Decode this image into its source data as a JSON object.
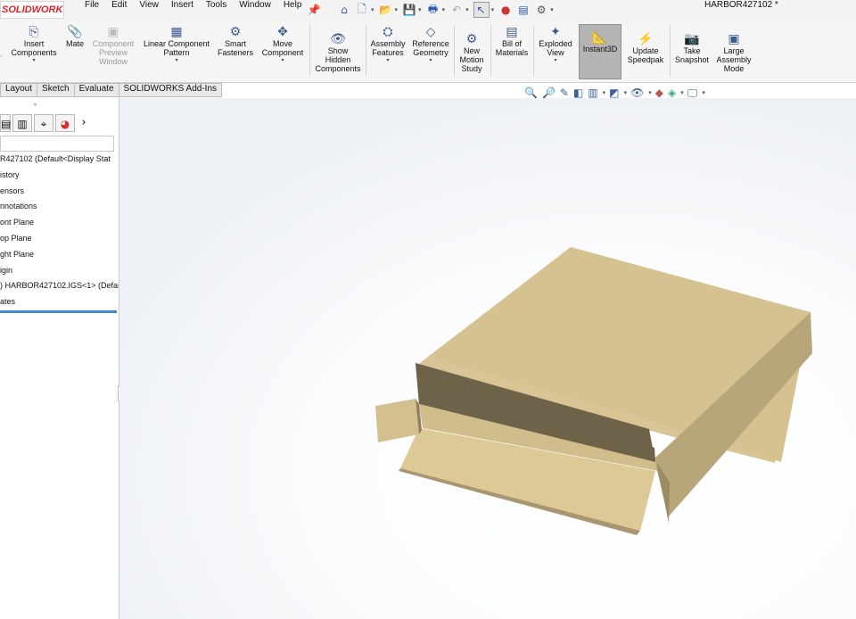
{
  "app": {
    "logo": "SOLIDWORKS",
    "document_title": "HARBOR427102 *"
  },
  "menu": {
    "items": [
      "File",
      "Edit",
      "View",
      "Insert",
      "Tools",
      "Window",
      "Help"
    ]
  },
  "quick_access": [
    "pin-icon",
    "home-icon",
    "new-icon",
    "open-icon",
    "save-icon",
    "print-icon",
    "undo-icon",
    "select-icon",
    "traffic-light-icon",
    "options-icon",
    "settings-icon"
  ],
  "ribbon": {
    "insert_components": "Insert\nComponents",
    "mate": "Mate",
    "component_preview": "Component\nPreview\nWindow",
    "linear_pattern": "Linear Component\nPattern",
    "smart_fasteners": "Smart\nFasteners",
    "move_component": "Move\nComponent",
    "show_hidden": "Show\nHidden\nComponents",
    "assembly_features": "Assembly\nFeatures",
    "reference_geometry": "Reference\nGeometry",
    "new_motion_study": "New\nMotion\nStudy",
    "bill_of_materials": "Bill of\nMaterials",
    "exploded_view": "Exploded\nView",
    "instant3d": "Instant3D",
    "update_speedpak": "Update\nSpeedpak",
    "take_snapshot": "Take\nSnapshot",
    "large_assembly_mode": "Large\nAssembly\nMode"
  },
  "tabs": [
    "Layout",
    "Sketch",
    "Evaluate",
    "SOLIDWORKS Add-Ins"
  ],
  "panel_tabs_chevron": "›",
  "tree": [
    "R427102  (Default<Display Stat",
    "istory",
    "ensors",
    "nnotations",
    "ont Plane",
    "op Plane",
    "ght Plane",
    "igin",
    ") HARBOR427102.IGS<1> (Defau",
    "ates"
  ],
  "colors": {
    "model_top": "#d8c494",
    "model_side": "#a99970",
    "model_dark": "#6b5f46",
    "accent": "#3b8cc7"
  }
}
